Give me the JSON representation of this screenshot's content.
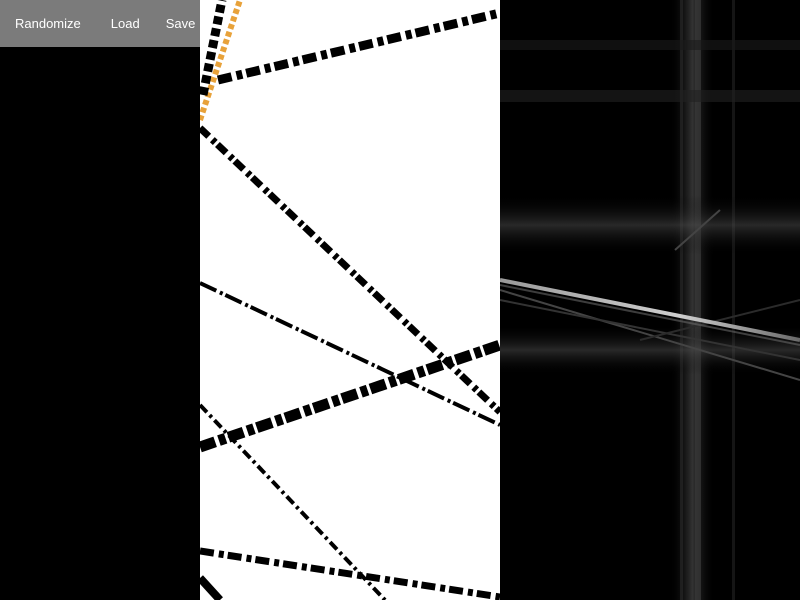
{
  "toolbar": {
    "randomize_label": "Randomize",
    "load_label": "Load",
    "save_label": "Save"
  },
  "colors": {
    "toolbar_bg": "#7b7b7b",
    "canvas_bg": "#ffffff",
    "line_color": "#000000",
    "accent_orange": "#e8a23a",
    "transform_bg": "#000000"
  }
}
